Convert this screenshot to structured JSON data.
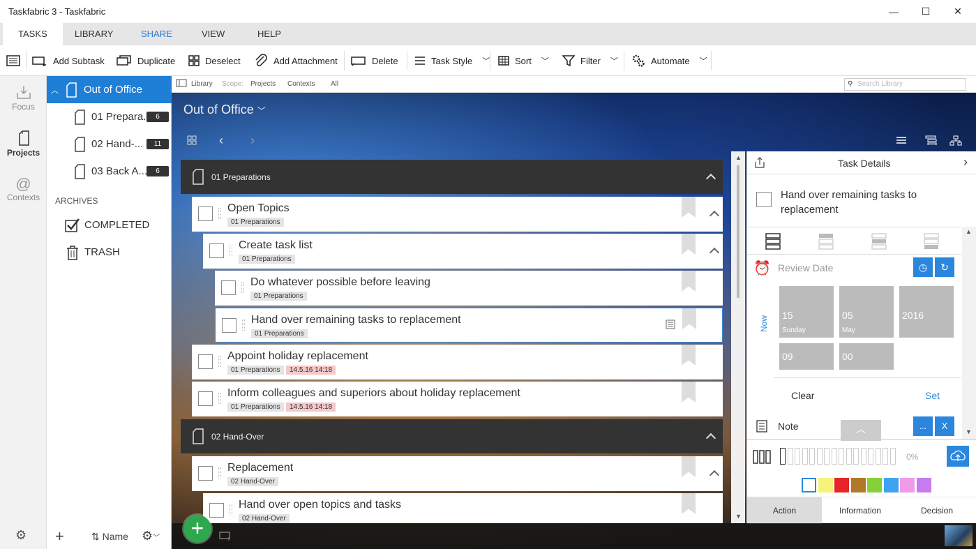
{
  "window": {
    "title": "Taskfabric 3 - Taskfabric",
    "minimize": "—",
    "maximize": "☐",
    "close": "✕"
  },
  "tabs": [
    {
      "label": "TASKS"
    },
    {
      "label": "LIBRARY"
    },
    {
      "label": "SHARE"
    },
    {
      "label": "VIEW"
    },
    {
      "label": "HELP"
    }
  ],
  "ribbon": {
    "add_subtask": "Add Subtask",
    "duplicate": "Duplicate",
    "deselect": "Deselect",
    "add_attachment": "Add Attachment",
    "delete": "Delete",
    "task_style": "Task Style",
    "sort": "Sort",
    "filter": "Filter",
    "automate": "Automate"
  },
  "leftnav": {
    "focus": "Focus",
    "projects": "Projects",
    "contexts": "Contexts"
  },
  "projects": {
    "root": "Out of Office",
    "children": [
      {
        "label": "01 Prepara...",
        "count": "6"
      },
      {
        "label": "02 Hand-...",
        "count": "11"
      },
      {
        "label": "03 Back A...",
        "count": "6"
      }
    ],
    "archives_label": "ARCHIVES",
    "completed": "COMPLETED",
    "trash": "TRASH",
    "footer_sort": "Name"
  },
  "scopebar": {
    "library": "Library",
    "scope": "Scope:",
    "projects": "Projects",
    "contexts": "Contexts",
    "all": "All",
    "search_placeholder": "Search Library"
  },
  "header": {
    "project_title": "Out of Office"
  },
  "groups": {
    "g1": "01 Preparations",
    "g2": "02 Hand-Over"
  },
  "tasks": {
    "t1": {
      "title": "Open Topics",
      "tag": "01 Preparations"
    },
    "t2": {
      "title": "Create task list",
      "tag": "01 Preparations"
    },
    "t3": {
      "title": "Do whatever possible before leaving",
      "tag": "01 Preparations"
    },
    "t4": {
      "title": "Hand over remaining tasks to replacement",
      "tag": "01 Preparations"
    },
    "t5": {
      "title": "Appoint holiday replacement",
      "tag": "01 Preparations",
      "date": "14.5.16 14:18"
    },
    "t6": {
      "title": "Inform colleagues and superiors about holiday replacement",
      "tag": "01 Preparations",
      "date": "14.5.16 14:18"
    },
    "t7": {
      "title": "Replacement",
      "tag": "02 Hand-Over"
    },
    "t8": {
      "title": "Hand over open topics and tasks",
      "tag": "02 Hand-Over"
    }
  },
  "details": {
    "header": "Task Details",
    "task_title": "Hand over remaining tasks to replacement",
    "review_label": "Review Date",
    "now_label": "Now",
    "day": "15",
    "weekday": "Sunday",
    "month": "05",
    "month_name": "May",
    "year": "2016",
    "hour": "09",
    "minute": "00",
    "clear": "Clear",
    "set": "Set",
    "note": "Note",
    "note_more": "...",
    "note_close": "X",
    "progress": "0%",
    "tabs": [
      "Action",
      "Information",
      "Decision"
    ]
  },
  "colors": {
    "accent": "#1f7fd6",
    "swatches": [
      "#ffffff",
      "#f7f27a",
      "#e8232a",
      "#b07828",
      "#86d13a",
      "#3ea3f0",
      "#f09ae8",
      "#c77bf0"
    ]
  }
}
